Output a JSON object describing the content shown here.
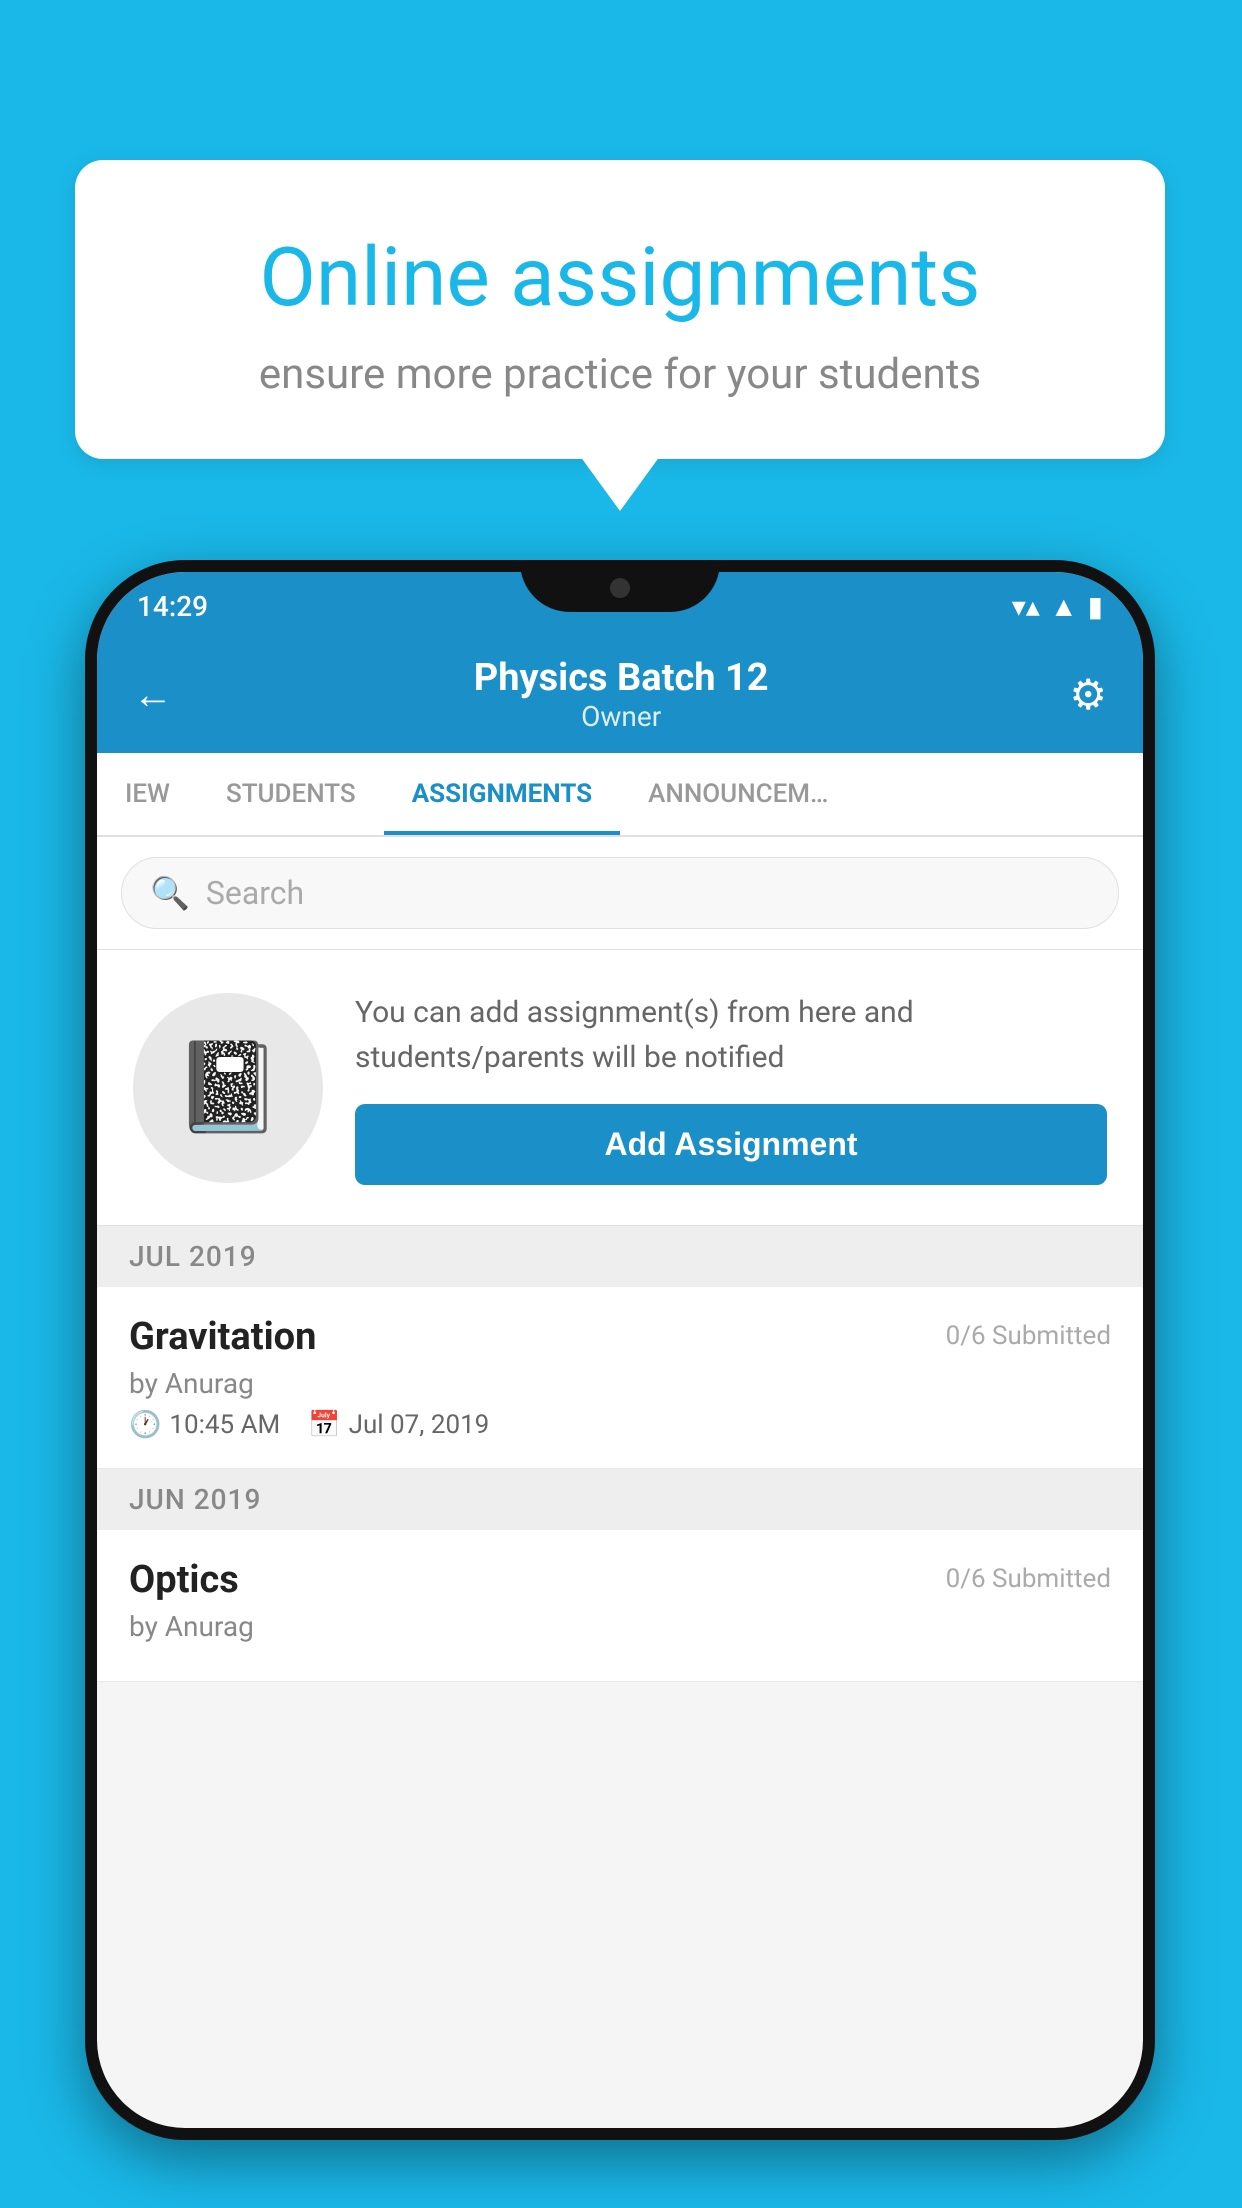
{
  "background": {
    "color": "#1ab8e8"
  },
  "bubble": {
    "title": "Online assignments",
    "subtitle": "ensure more practice for your students"
  },
  "status_bar": {
    "time": "14:29",
    "wifi": "▼",
    "signal": "▲",
    "battery": "▮"
  },
  "header": {
    "title": "Physics Batch 12",
    "subtitle": "Owner",
    "back_label": "←",
    "gear_label": "⚙"
  },
  "tabs": [
    {
      "id": "overview",
      "label": "IEW",
      "active": false
    },
    {
      "id": "students",
      "label": "STUDENTS",
      "active": false
    },
    {
      "id": "assignments",
      "label": "ASSIGNMENTS",
      "active": true
    },
    {
      "id": "announcements",
      "label": "ANNOUNCEM...",
      "active": false
    }
  ],
  "search": {
    "placeholder": "Search"
  },
  "promo": {
    "text": "You can add assignment(s) from here and students/parents will be notified",
    "button_label": "Add Assignment"
  },
  "sections": [
    {
      "month": "JUL 2019",
      "assignments": [
        {
          "name": "Gravitation",
          "submitted": "0/6 Submitted",
          "author": "by Anurag",
          "time": "10:45 AM",
          "date": "Jul 07, 2019"
        }
      ]
    },
    {
      "month": "JUN 2019",
      "assignments": [
        {
          "name": "Optics",
          "submitted": "0/6 Submitted",
          "author": "by Anurag",
          "time": "",
          "date": ""
        }
      ]
    }
  ]
}
